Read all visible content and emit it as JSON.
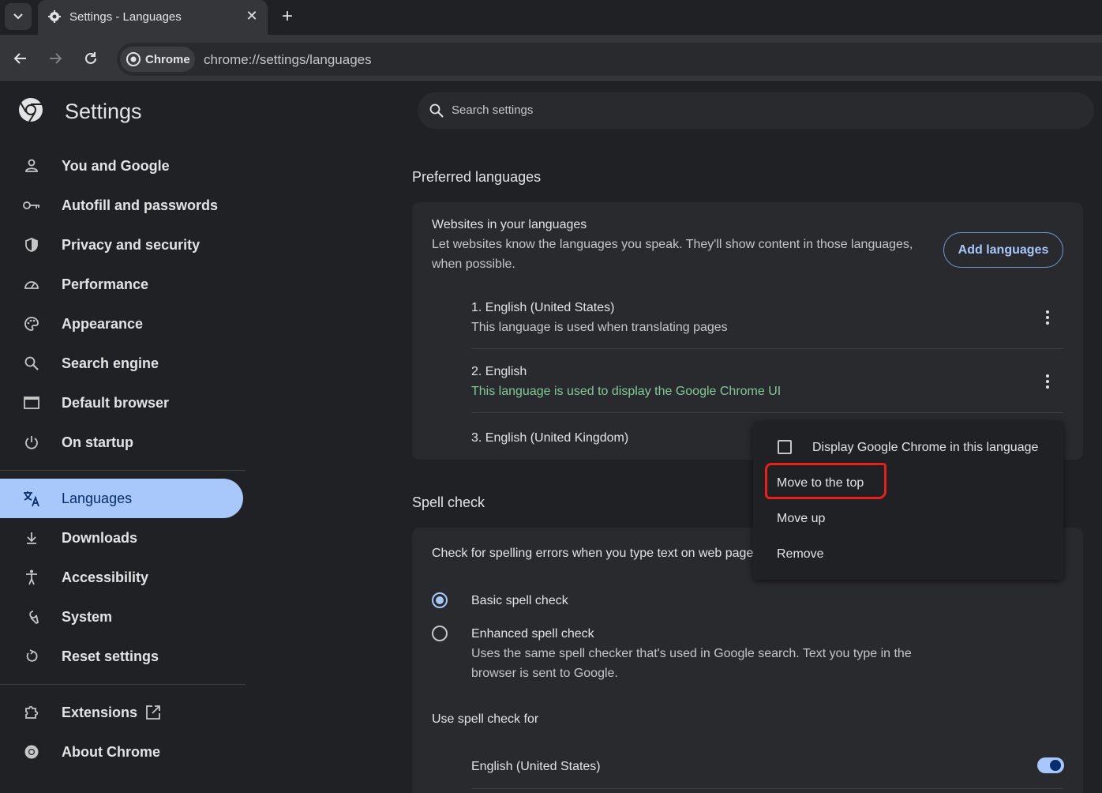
{
  "browser": {
    "tab_title": "Settings - Languages",
    "chip_label": "Chrome",
    "url": "chrome://settings/languages"
  },
  "sidebar": {
    "title": "Settings",
    "items": [
      {
        "label": "You and Google",
        "icon": "person-icon"
      },
      {
        "label": "Autofill and passwords",
        "icon": "key-icon"
      },
      {
        "label": "Privacy and security",
        "icon": "shield-icon"
      },
      {
        "label": "Performance",
        "icon": "speedometer-icon"
      },
      {
        "label": "Appearance",
        "icon": "palette-icon"
      },
      {
        "label": "Search engine",
        "icon": "search-icon"
      },
      {
        "label": "Default browser",
        "icon": "browser-window-icon"
      },
      {
        "label": "On startup",
        "icon": "power-icon"
      },
      {
        "label": "Languages",
        "icon": "translate-icon",
        "active": true
      },
      {
        "label": "Downloads",
        "icon": "download-icon"
      },
      {
        "label": "Accessibility",
        "icon": "accessibility-icon"
      },
      {
        "label": "System",
        "icon": "wrench-icon"
      },
      {
        "label": "Reset settings",
        "icon": "reset-icon"
      },
      {
        "label": "Extensions",
        "icon": "puzzle-icon"
      },
      {
        "label": "About Chrome",
        "icon": "chrome-icon"
      }
    ]
  },
  "search": {
    "placeholder": "Search settings"
  },
  "preferred": {
    "title": "Preferred languages",
    "heading": "Websites in your languages",
    "description": "Let websites know the languages you speak. They'll show content in those languages, when possible.",
    "add_button": "Add languages",
    "languages": [
      {
        "name": "1. English (United States)",
        "note": "This language is used when translating pages"
      },
      {
        "name": "2. English",
        "note": "This language is used to display the Google Chrome UI"
      },
      {
        "name": "3. English (United Kingdom)",
        "note": ""
      }
    ]
  },
  "spell": {
    "title": "Spell check",
    "check_label": "Check for spelling errors when you type text on web pages",
    "basic_label": "Basic spell check",
    "enhanced_label": "Enhanced spell check",
    "enhanced_desc": "Uses the same spell checker that's used in Google search. Text you type in the browser is sent to Google.",
    "use_for_label": "Use spell check for",
    "languages": [
      {
        "name": "English (United States)",
        "enabled": true
      }
    ]
  },
  "context_menu": {
    "items": [
      {
        "label": "Display Google Chrome in this language",
        "checked": false
      },
      {
        "label": "Move to the top",
        "highlighted": true
      },
      {
        "label": "Move up"
      },
      {
        "label": "Remove"
      }
    ]
  },
  "colors": {
    "accent": "#a8c7fa",
    "green_note": "#81c995",
    "annotation": "#e8201a"
  }
}
